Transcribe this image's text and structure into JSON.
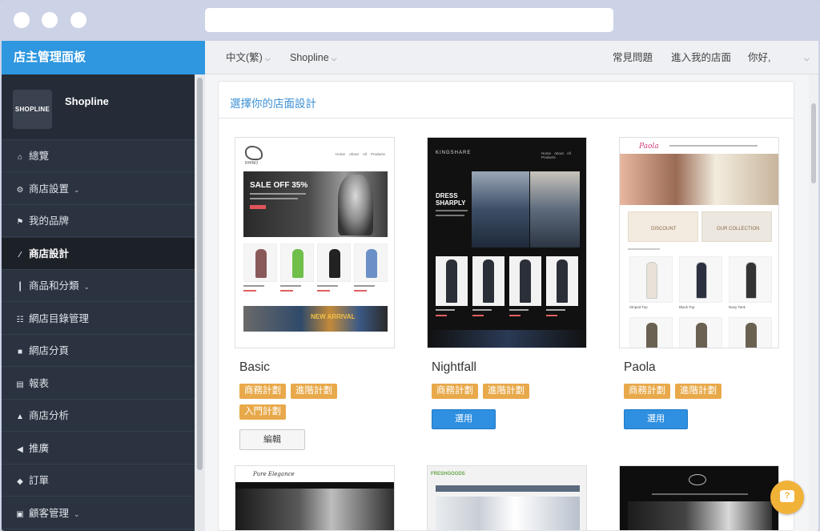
{
  "sidebar": {
    "title": "店主管理面板",
    "store_logo_text": "SHOPLINE",
    "store_name": "Shopline",
    "items": [
      {
        "label": "總覽",
        "icon": "home-icon",
        "has_submenu": false,
        "active": false
      },
      {
        "label": "商店設置",
        "icon": "gear-icon",
        "has_submenu": true,
        "active": false
      },
      {
        "label": "我的品牌",
        "icon": "flag-icon",
        "has_submenu": false,
        "active": false
      },
      {
        "label": "商店設計",
        "icon": "magic-wand-icon",
        "has_submenu": false,
        "active": true
      },
      {
        "label": "商品和分類",
        "icon": "barcode-icon",
        "has_submenu": true,
        "active": false
      },
      {
        "label": "網店目錄管理",
        "icon": "sitemap-icon",
        "has_submenu": false,
        "active": false
      },
      {
        "label": "網店分頁",
        "icon": "file-icon",
        "has_submenu": false,
        "active": false
      },
      {
        "label": "報表",
        "icon": "bar-chart-icon",
        "has_submenu": false,
        "active": false
      },
      {
        "label": "商店分析",
        "icon": "flask-icon",
        "has_submenu": false,
        "active": false
      },
      {
        "label": "推廣",
        "icon": "bullhorn-icon",
        "has_submenu": false,
        "active": false
      },
      {
        "label": "訂單",
        "icon": "tag-icon",
        "has_submenu": false,
        "active": false
      },
      {
        "label": "顧客管理",
        "icon": "customers-icon",
        "has_submenu": true,
        "active": false
      }
    ]
  },
  "topnav": {
    "language": "中文(繁)",
    "store_switch": "Shopline",
    "faq": "常見問題",
    "enter_store": "進入我的店面",
    "greeting": "你好,"
  },
  "main": {
    "title": "選擇你的店面設計",
    "themes": [
      {
        "name": "Basic",
        "badges": [
          "商務計劃",
          "進階計劃",
          "入門計劃"
        ],
        "action": "編輯"
      },
      {
        "name": "Nightfall",
        "badges": [
          "商務計劃",
          "進階計劃"
        ],
        "action": "選用"
      },
      {
        "name": "Paola",
        "badges": [
          "商務計劃",
          "進階計劃"
        ],
        "action": "選用"
      }
    ],
    "previews": {
      "basic": {
        "logo": "RHINO",
        "nav": [
          "Home",
          "About",
          "All Products"
        ],
        "sale": "SALE OFF 35%",
        "banner": "NEW ARRIVAL"
      },
      "nightfall": {
        "logo": "KINGSHARE",
        "nav": [
          "Home",
          "About",
          "All Products"
        ],
        "headline": "DRESS SHARPLY"
      },
      "paola": {
        "logo": "Paola",
        "banner_left": "DISCOUNT",
        "banner_right": "OUR COLLECTION",
        "products": [
          "Striped Top",
          "Black Top",
          "Navy Tank"
        ]
      },
      "elegance": {
        "logo": "Pure Elegance"
      },
      "freshgoods": {
        "logo": "FRESHGOODS"
      }
    }
  },
  "colors": {
    "sidebar_bg": "#2b3340",
    "sidebar_header": "#2f97e0",
    "badge": "#e8a94a",
    "primary_button": "#2f8fe0",
    "title_blue": "#3a8fd6",
    "help_button": "#f1b238"
  }
}
